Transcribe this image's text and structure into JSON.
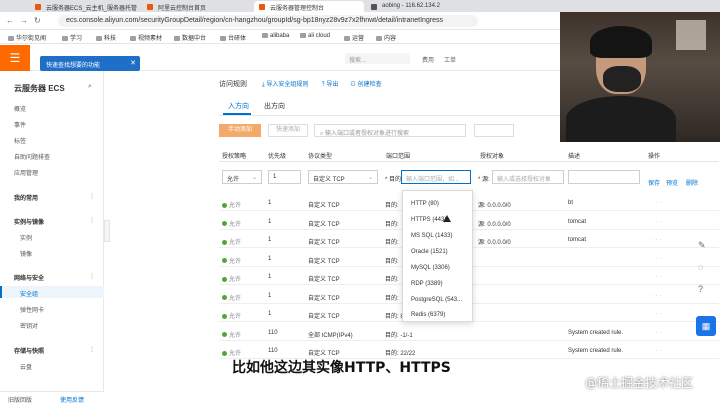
{
  "browser": {
    "tabs": [
      {
        "label": "云服务器ECS_云主机_服务器托管"
      },
      {
        "label": "阿里云控制台首页"
      },
      {
        "label": "云服务器管理控制台"
      },
      {
        "label": "aobing - 116.62.134.2"
      }
    ],
    "url": "ecs.console.aliyun.com/securityGroupDetail/region/cn-hangzhou/groupId/sg-bp18nyz28v9z7x2fhnwt/detail/intranetIngress",
    "bookmarks": [
      "华尔街见闻",
      "学习",
      "科技",
      "视频素材",
      "数据中台",
      "台研体",
      "alibaba",
      "ali cloud",
      "运营",
      "内容"
    ]
  },
  "console": {
    "tooltip": "快速查找想要的功能",
    "search_placeholder": "搜索...",
    "top_links": [
      "费用",
      "工单"
    ]
  },
  "sidebar": {
    "title": "云服务器 ECS",
    "items": [
      "概览",
      "事件",
      "标签",
      "自助问题排查",
      "应用管理"
    ],
    "groups": [
      {
        "label": "我的常用"
      },
      {
        "label": "实例与镜像",
        "items": [
          "实例",
          "镜像"
        ]
      },
      {
        "label": "网络与安全",
        "items": [
          "安全组",
          "弹性网卡",
          "密钥对"
        ]
      },
      {
        "label": "存储与快照",
        "items": [
          "云盘"
        ]
      }
    ],
    "footer": {
      "left": "旧版回版",
      "right": "使用反馈"
    }
  },
  "main": {
    "section_title": "访问规则",
    "links": [
      "导入安全组规则",
      "导出",
      "创建检查"
    ],
    "tabs": [
      "入方向",
      "出方向"
    ],
    "add_button": "手动添加",
    "quick_button": "快速添加",
    "filter_placeholder": "输入端口或者授权对象进行搜索",
    "columns": [
      "授权策略",
      "优先级",
      "协议类型",
      "端口范围",
      "授权对象",
      "描述",
      "操作"
    ],
    "input_row": {
      "policy": "允许",
      "priority": "1",
      "protocol": "自定义 TCP",
      "port_prefix": "* 目的:",
      "port_placeholder": "输入端口范围，如...",
      "auth_prefix": "* 源:",
      "auth_placeholder": "输入或选择授权对象",
      "actions": [
        "保存",
        "预览",
        "删除"
      ]
    },
    "rows": [
      {
        "policy": "允许",
        "priority": "1",
        "protocol": "自定义 TCP",
        "port": "目的:",
        "source": "源: 0.0.0.0/0",
        "desc": "bt"
      },
      {
        "policy": "允许",
        "priority": "1",
        "protocol": "自定义 TCP",
        "port": "目的:",
        "source": "源: 0.0.0.0/0",
        "desc": "tomcat"
      },
      {
        "policy": "允许",
        "priority": "1",
        "protocol": "自定义 TCP",
        "port": "目的:",
        "source": "源: 0.0.0.0/0",
        "desc": "tomcat"
      },
      {
        "policy": "允许",
        "priority": "1",
        "protocol": "自定义 TCP",
        "port": "目的:",
        "source": "",
        "desc": ""
      },
      {
        "policy": "允许",
        "priority": "1",
        "protocol": "自定义 TCP",
        "port": "目的:",
        "source": "",
        "desc": ""
      },
      {
        "policy": "允许",
        "priority": "1",
        "protocol": "自定义 TCP",
        "port": "目的:",
        "source": "",
        "desc": ""
      },
      {
        "policy": "允许",
        "priority": "1",
        "protocol": "自定义 TCP",
        "port": "目的: 8080/8080",
        "source": "",
        "desc": ""
      },
      {
        "policy": "允许",
        "priority": "110",
        "protocol": "全部 ICMP(IPv4)",
        "port": "目的: -1/-1",
        "source": "",
        "desc": "System created rule."
      },
      {
        "policy": "允许",
        "priority": "110",
        "protocol": "自定义 TCP",
        "port": "目的: 22/22",
        "source": "",
        "desc": "System created rule."
      }
    ],
    "dropdown": [
      "HTTP (80)",
      "HTTPS (443)",
      "MS SQL (1433)",
      "Oracle (1521)",
      "MySQL (3306)",
      "RDP (3389)",
      "PostgreSQL (543...",
      "Redis (6379)"
    ]
  },
  "overlay": {
    "subtitle": "比如他这边其实像HTTP、HTTPS",
    "watermark": "@稀土掘金技术社区"
  }
}
